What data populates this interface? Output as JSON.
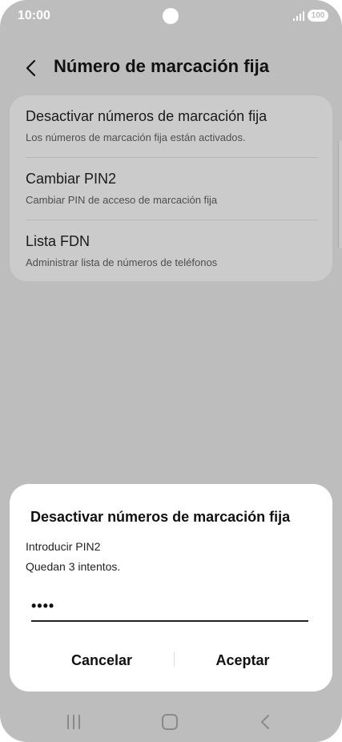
{
  "status": {
    "time": "10:00",
    "battery": "100"
  },
  "header": {
    "back_icon": "arrow-left-icon",
    "title": "Número de marcación fija"
  },
  "settings": [
    {
      "label": "Desactivar números de marcación fija",
      "sub": "Los números de marcación fija están activados."
    },
    {
      "label": "Cambiar PIN2",
      "sub": "Cambiar PIN de acceso de marcación fija"
    },
    {
      "label": "Lista FDN",
      "sub": "Administrar lista de números de teléfonos"
    }
  ],
  "dialog": {
    "title": "Desactivar números de marcación fija",
    "line1": "Introducir PIN2",
    "line2": "Quedan 3 intentos.",
    "pin_value": "••••",
    "cancel": "Cancelar",
    "accept": "Aceptar"
  },
  "nav": {
    "recents_icon": "recents-icon",
    "home_icon": "home-icon",
    "back_icon": "nav-back-icon"
  },
  "colors": {
    "dimmed_background": "#bdbdbd",
    "card": "#cbcbcb",
    "dialog": "#ffffff"
  }
}
